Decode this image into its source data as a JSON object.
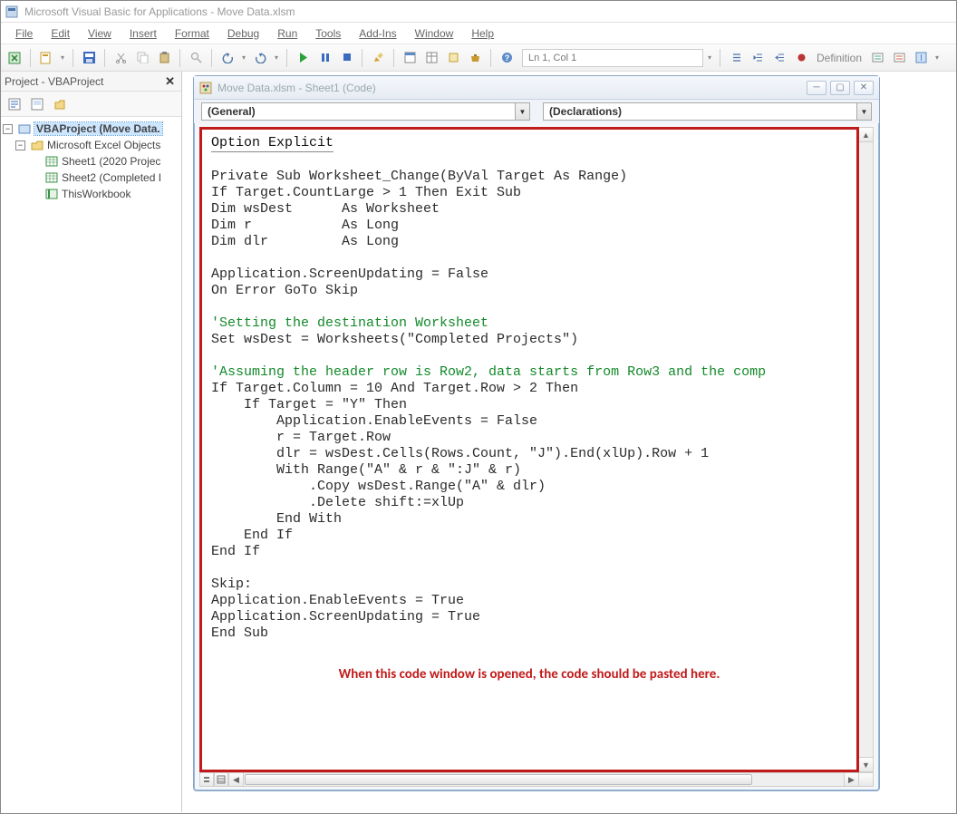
{
  "app": {
    "title": "Microsoft Visual Basic for Applications - Move Data.xlsm"
  },
  "menu": {
    "file": "File",
    "edit": "Edit",
    "view": "View",
    "insert": "Insert",
    "format": "Format",
    "debug": "Debug",
    "run": "Run",
    "tools": "Tools",
    "addins": "Add-Ins",
    "window": "Window",
    "help": "Help"
  },
  "toolbar": {
    "cursor_position": "Ln 1, Col 1",
    "definition_label": "Definition"
  },
  "project_panel": {
    "title": "Project - VBAProject",
    "root": "VBAProject (Move Data.",
    "group": "Microsoft Excel Objects",
    "items": [
      "Sheet1 (2020 Projec",
      "Sheet2 (Completed I",
      "ThisWorkbook"
    ]
  },
  "code_window": {
    "title": "Move Data.xlsm - Sheet1 (Code)",
    "combo_left": "(General)",
    "combo_right": "(Declarations)",
    "annotation": "When this code window is opened, the code should be pasted here.",
    "code_lines": [
      {
        "type": "decl",
        "text": "Option Explicit"
      },
      {
        "type": "blank",
        "text": ""
      },
      {
        "type": "plain",
        "text": "Private Sub Worksheet_Change(ByVal Target As Range)"
      },
      {
        "type": "plain",
        "text": "If Target.CountLarge > 1 Then Exit Sub"
      },
      {
        "type": "plain",
        "text": "Dim wsDest      As Worksheet"
      },
      {
        "type": "plain",
        "text": "Dim r           As Long"
      },
      {
        "type": "plain",
        "text": "Dim dlr         As Long"
      },
      {
        "type": "blank",
        "text": ""
      },
      {
        "type": "plain",
        "text": "Application.ScreenUpdating = False"
      },
      {
        "type": "plain",
        "text": "On Error GoTo Skip"
      },
      {
        "type": "blank",
        "text": ""
      },
      {
        "type": "comment",
        "text": "'Setting the destination Worksheet"
      },
      {
        "type": "plain",
        "text": "Set wsDest = Worksheets(\"Completed Projects\")"
      },
      {
        "type": "blank",
        "text": ""
      },
      {
        "type": "comment",
        "text": "'Assuming the header row is Row2, data starts from Row3 and the comp"
      },
      {
        "type": "plain",
        "text": "If Target.Column = 10 And Target.Row > 2 Then"
      },
      {
        "type": "plain",
        "text": "    If Target = \"Y\" Then"
      },
      {
        "type": "plain",
        "text": "        Application.EnableEvents = False"
      },
      {
        "type": "plain",
        "text": "        r = Target.Row"
      },
      {
        "type": "plain",
        "text": "        dlr = wsDest.Cells(Rows.Count, \"J\").End(xlUp).Row + 1"
      },
      {
        "type": "plain",
        "text": "        With Range(\"A\" & r & \":J\" & r)"
      },
      {
        "type": "plain",
        "text": "            .Copy wsDest.Range(\"A\" & dlr)"
      },
      {
        "type": "plain",
        "text": "            .Delete shift:=xlUp"
      },
      {
        "type": "plain",
        "text": "        End With"
      },
      {
        "type": "plain",
        "text": "    End If"
      },
      {
        "type": "plain",
        "text": "End If"
      },
      {
        "type": "blank",
        "text": ""
      },
      {
        "type": "plain",
        "text": "Skip:"
      },
      {
        "type": "plain",
        "text": "Application.EnableEvents = True"
      },
      {
        "type": "plain",
        "text": "Application.ScreenUpdating = True"
      },
      {
        "type": "plain",
        "text": "End Sub"
      }
    ]
  }
}
